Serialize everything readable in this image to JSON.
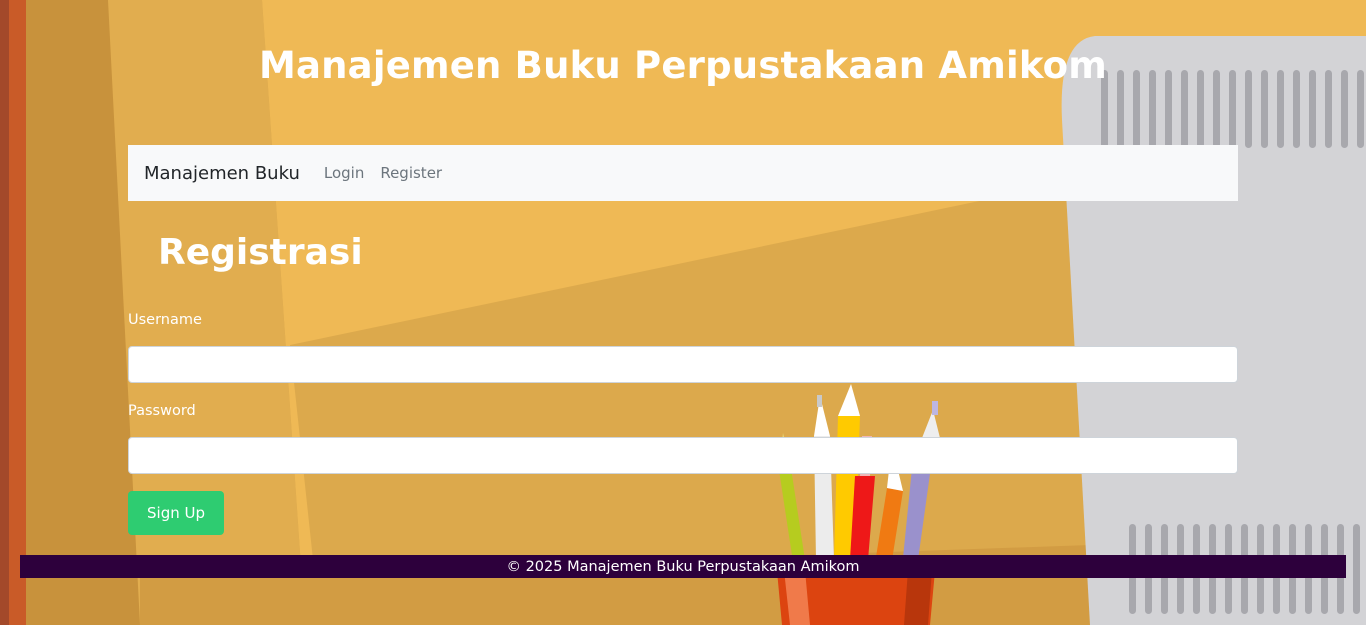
{
  "header": {
    "title": "Manajemen Buku Perpustakaan Amikom"
  },
  "navbar": {
    "brand": "Manajemen Buku",
    "links": [
      {
        "label": "Login"
      },
      {
        "label": "Register"
      }
    ]
  },
  "form": {
    "heading": "Registrasi",
    "username": {
      "label": "Username",
      "value": "",
      "placeholder": ""
    },
    "password": {
      "label": "Password",
      "value": "",
      "placeholder": ""
    },
    "submit_label": "Sign Up"
  },
  "footer": {
    "text": "© 2025 Manajemen Buku Perpustakaan Amikom"
  },
  "colors": {
    "background": "#efb955",
    "navbar": "#f8f9fa",
    "button": "#2ecc71",
    "footer": "#2d003c"
  }
}
